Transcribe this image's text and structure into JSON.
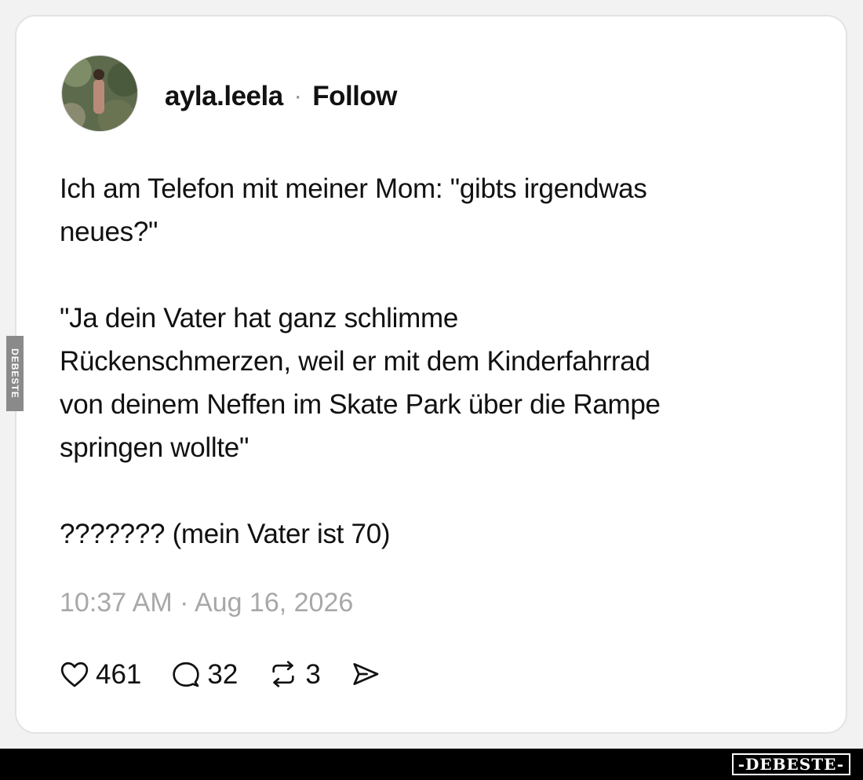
{
  "post": {
    "username": "ayla.leela",
    "separator": "·",
    "follow_label": "Follow",
    "text": "Ich am Telefon mit meiner Mom: \"gibts irgendwas\nneues?\"\n\n\"Ja dein Vater hat ganz schlimme\nRückenschmerzen, weil er mit dem Kinderfahrrad\nvon deinem Neffen im Skate Park über die Rampe\nspringen wollte\"\n\n??????? (mein Vater ist 70)",
    "timestamp": "10:37 AM · Aug 16, 2026",
    "likes": "461",
    "replies": "32",
    "reposts": "3"
  },
  "icons": {
    "like": "heart-icon",
    "reply": "speech-bubble-icon",
    "repost": "repost-arrows-icon",
    "share": "send-icon"
  },
  "watermark": {
    "side_label": "DEBESTE",
    "brand_label": "-DEBESTE-"
  }
}
